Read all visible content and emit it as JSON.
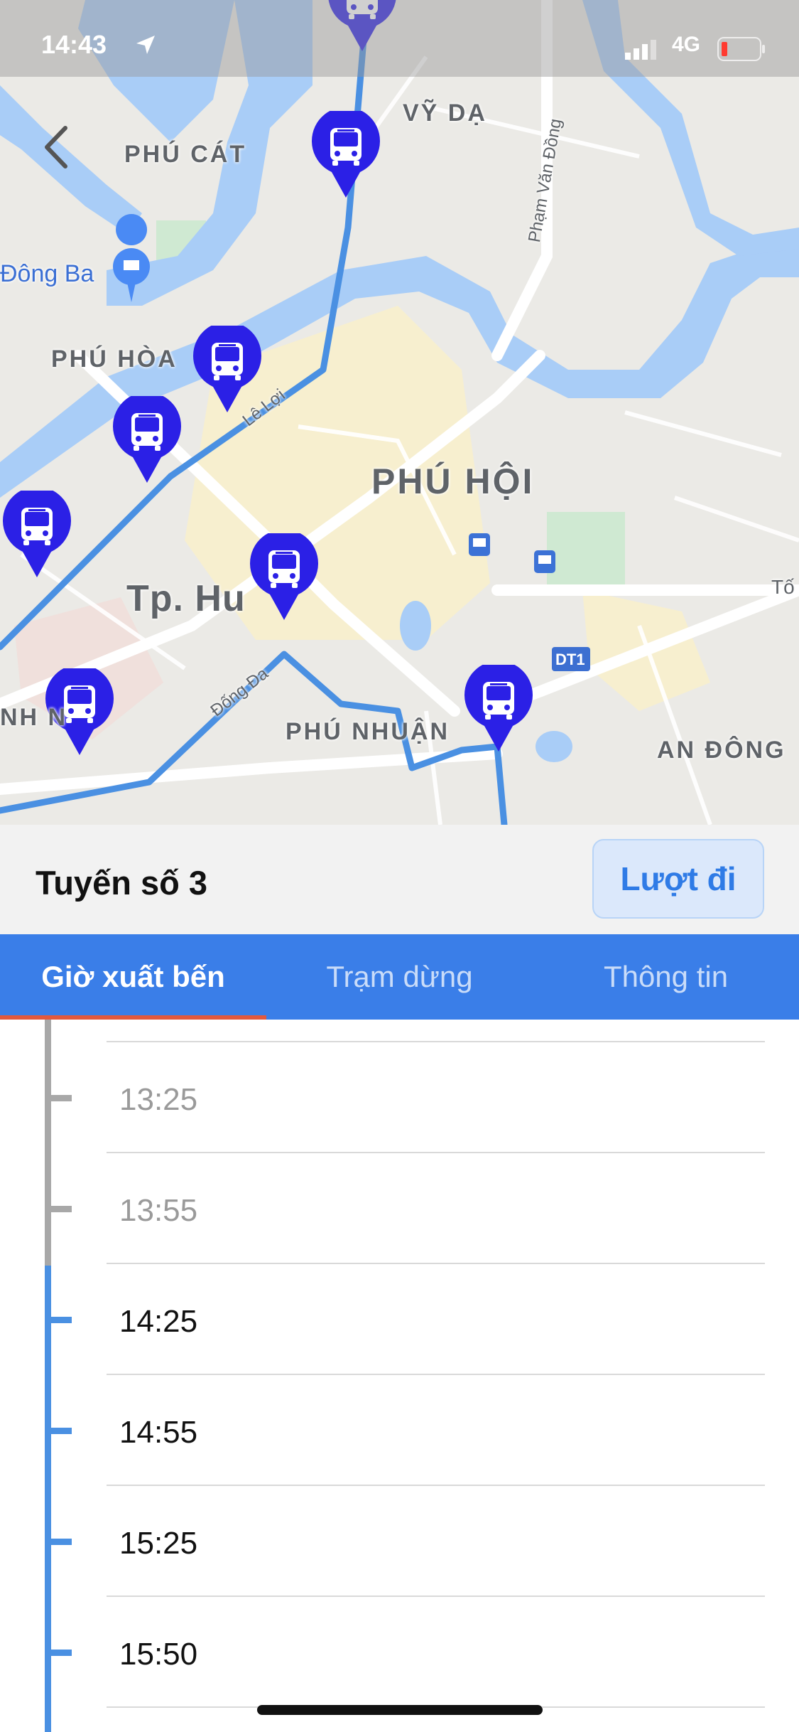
{
  "status_bar": {
    "time": "14:43",
    "network": "4G"
  },
  "map": {
    "labels": {
      "vy_da": "VỸ DẠ",
      "phu_cat": "PHÚ CÁT",
      "dong_ba": "Đông Ba",
      "phu_hoa": "PHÚ HÒA",
      "phu_hoi": "PHÚ HỘI",
      "tp_hue": "Tp. Hu",
      "nh_n": "NH N",
      "phu_nhuan": "PHÚ NHUẬN",
      "an_dong": "AN ĐÔNG",
      "to": "Tố",
      "le_loi": "Lê Lợi",
      "dong_da": "Đống Đa",
      "pham_van_dong": "Phạm Văn Đồng",
      "dt1": "DT1"
    },
    "colors": {
      "route": "#4a90e2",
      "bus_marker": "#2b20e6",
      "water": "#a9cdf7"
    }
  },
  "route": {
    "title": "Tuyến số 3",
    "direction_label": "Lượt đi"
  },
  "tabs": [
    {
      "label": "Giờ xuất bến",
      "active": true
    },
    {
      "label": "Trạm dừng",
      "active": false
    },
    {
      "label": "Thông tin",
      "active": false
    }
  ],
  "schedule": [
    {
      "time": "13:25",
      "past": true
    },
    {
      "time": "13:55",
      "past": true
    },
    {
      "time": "14:25",
      "past": false
    },
    {
      "time": "14:55",
      "past": false
    },
    {
      "time": "15:25",
      "past": false
    },
    {
      "time": "15:50",
      "past": false
    }
  ],
  "colors": {
    "accent": "#3a7ee8",
    "tab_indicator": "#e2593d",
    "past_time": "#9a9a9a",
    "timeline_past": "#a8a8a8",
    "timeline_future": "#4a90e2"
  }
}
